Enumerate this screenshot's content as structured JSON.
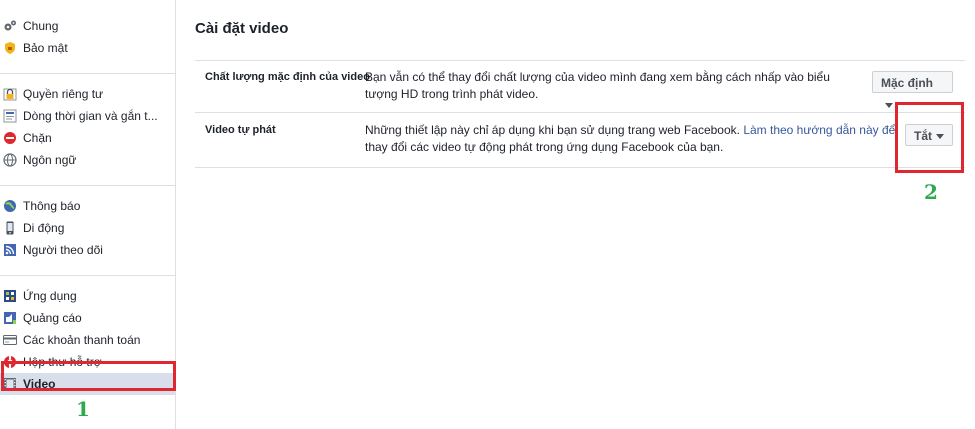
{
  "sidebar": {
    "group1": [
      {
        "label": "Chung",
        "icon": "gears-icon"
      },
      {
        "label": "Bảo mật",
        "icon": "shield-icon"
      }
    ],
    "group2": [
      {
        "label": "Quyền riêng tư",
        "icon": "lock-icon"
      },
      {
        "label": "Dòng thời gian và gắn t...",
        "icon": "timeline-icon"
      },
      {
        "label": "Chặn",
        "icon": "block-icon"
      },
      {
        "label": "Ngôn ngữ",
        "icon": "globe-icon"
      }
    ],
    "group3": [
      {
        "label": "Thông báo",
        "icon": "globe-notification-icon"
      },
      {
        "label": "Di động",
        "icon": "mobile-icon"
      },
      {
        "label": "Người theo dõi",
        "icon": "rss-icon"
      }
    ],
    "group4": [
      {
        "label": "Ứng dụng",
        "icon": "apps-icon"
      },
      {
        "label": "Quảng cáo",
        "icon": "ads-icon"
      },
      {
        "label": "Các khoản thanh toán",
        "icon": "credit-card-icon"
      },
      {
        "label": "Hộp thư hỗ trợ",
        "icon": "lifebuoy-icon"
      },
      {
        "label": "Video",
        "icon": "film-icon"
      }
    ]
  },
  "main": {
    "title": "Cài đặt video",
    "rows": [
      {
        "label": "Chất lượng mặc định của video",
        "desc_line1": "Bạn vẫn có thể thay đổi chất lượng của video mình đang xem bằng cách nhấp vào biểu",
        "desc_line2": "tượng HD trong trình phát video.",
        "button": "Mặc định"
      },
      {
        "label": "Video tự phát",
        "desc_line1_text": "Những thiết lập này chỉ áp dụng khi bạn sử dụng trang web Facebook. ",
        "desc_line1_link": "Làm theo hướng dẫn này để",
        "desc_line2": "thay đổi các video tự động phát trong ứng dụng Facebook của bạn.",
        "button": "Tắt"
      }
    ]
  },
  "annotations": {
    "marker1": "1",
    "marker2": "2",
    "highlight_color": "#e0262e",
    "marker_color": "#2fa84f"
  }
}
